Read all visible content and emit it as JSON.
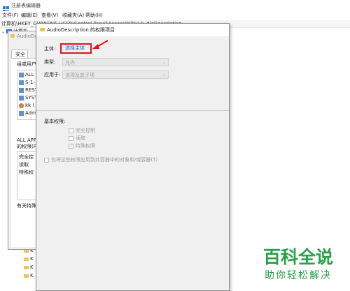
{
  "window": {
    "title": "注册表编辑器",
    "menu": [
      "文件(F)",
      "编辑(E)",
      "查看(V)",
      "收藏夹(A)",
      "帮助(H)"
    ],
    "address": "计算机\\HKEY_CURRENT_USER\\Control Panel\\Accessibility\\AudioDescription"
  },
  "tree": {
    "root_label": "计算机",
    "key_labels": [
      "K",
      "K",
      "K",
      "K"
    ]
  },
  "properties": {
    "title": "AudioDescription",
    "tab": "安全",
    "group_label": "组或用户",
    "users": [
      "ALL",
      "S-1-",
      "REST",
      "SYST",
      "kk (",
      "Adm"
    ],
    "perms_for": "ALL APP",
    "perms_for_2": "的权限(P)",
    "perm_rows": [
      "完全控",
      "读取",
      "特殊权"
    ],
    "advanced_hint": "有关特殊"
  },
  "dialog": {
    "title": "AudioDescription 的权限项目",
    "principal_label": "主体:",
    "principal_link": "选择主体",
    "type_label": "类型:",
    "type_value": "允许",
    "applies_label": "应用于:",
    "applies_value": "该项及其子项",
    "basic_perms_label": "基本权限:",
    "perms": [
      {
        "label": "完全控制",
        "checked": false
      },
      {
        "label": "读取",
        "checked": false
      },
      {
        "label": "特殊权限",
        "checked": true
      }
    ],
    "inherit_option": "仅将这些权限应用到此容器中的对象和/或容器(T)"
  },
  "watermark": {
    "line1": "百科全说",
    "line2": "助你轻松解决"
  },
  "colors": {
    "highlight_red": "#e0141c",
    "link_blue": "#1060c8",
    "watermark_green": "#2aa04a"
  }
}
